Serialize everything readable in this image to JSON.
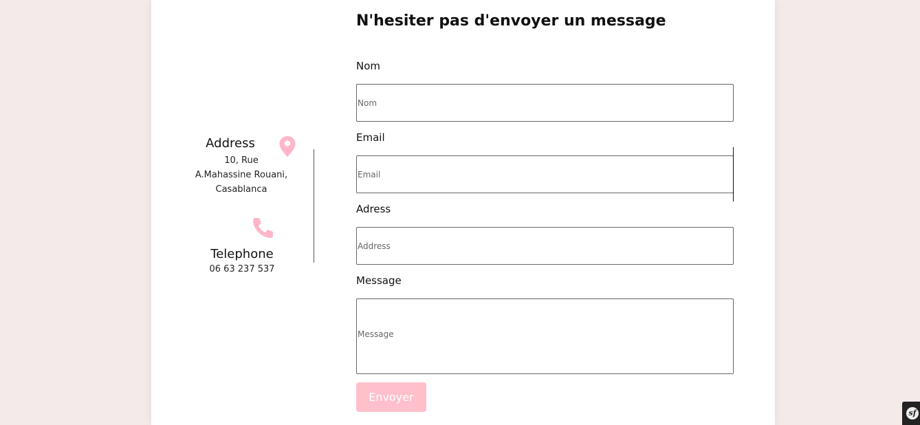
{
  "form": {
    "title": "N'hesiter pas d'envoyer un message",
    "fields": {
      "nom": {
        "label": "Nom",
        "placeholder": "Nom"
      },
      "email": {
        "label": "Email",
        "placeholder": "Email"
      },
      "address": {
        "label": "Adress",
        "placeholder": "Address"
      },
      "message": {
        "label": "Message",
        "placeholder": "Message"
      }
    },
    "submit_label": "Envoyer"
  },
  "contact": {
    "address_title": "Address",
    "address_line1": "10, Rue",
    "address_line2": "A.Mahassine Rouani,",
    "address_line3": "Casablanca",
    "telephone_title": "Telephone",
    "telephone_value": "06 63 237 537"
  },
  "toolbar_badge": {
    "label": "sf"
  },
  "colors": {
    "page_background": "#f5eaea",
    "card_background": "#ffffff",
    "accent_pink": "#ffc0cb",
    "icon_pink": "#ffb6c8"
  },
  "icons": {
    "address": "map-pin-icon",
    "telephone": "phone-icon",
    "toolbar": "symfony-icon"
  }
}
